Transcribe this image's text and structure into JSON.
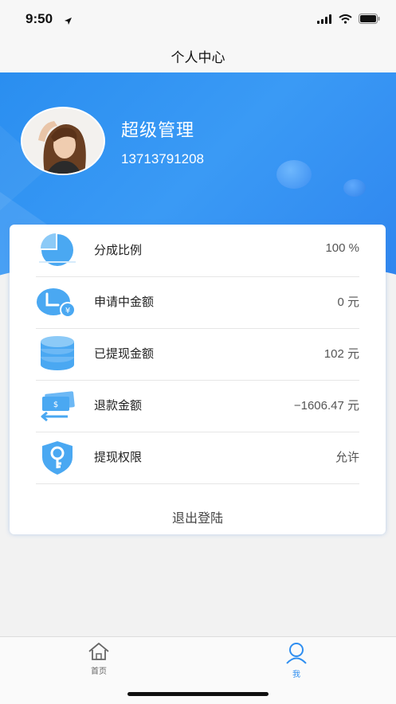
{
  "status_bar": {
    "time": "9:50"
  },
  "nav": {
    "title": "个人中心"
  },
  "profile": {
    "name": "超级管理",
    "phone": "13713791208"
  },
  "items": [
    {
      "label": "分成比例",
      "value": "100 %",
      "icon": "pie-chart-icon"
    },
    {
      "label": "申请中金额",
      "value": "0 元",
      "icon": "clock-yuan-icon"
    },
    {
      "label": "已提现金额",
      "value": "102 元",
      "icon": "coin-stack-icon"
    },
    {
      "label": "退款金额",
      "value": "−1606.47 元",
      "icon": "refund-cash-icon"
    },
    {
      "label": "提现权限",
      "value": "允许",
      "icon": "shield-key-icon"
    }
  ],
  "logout_label": "退出登陆",
  "tabs": [
    {
      "label": "首页",
      "icon": "home-icon"
    },
    {
      "label": "我",
      "icon": "user-icon"
    }
  ],
  "colors": {
    "accent": "#2f8ef0",
    "icon_blue": "#4aa3f0",
    "active_tab": "#2f8ef0"
  }
}
